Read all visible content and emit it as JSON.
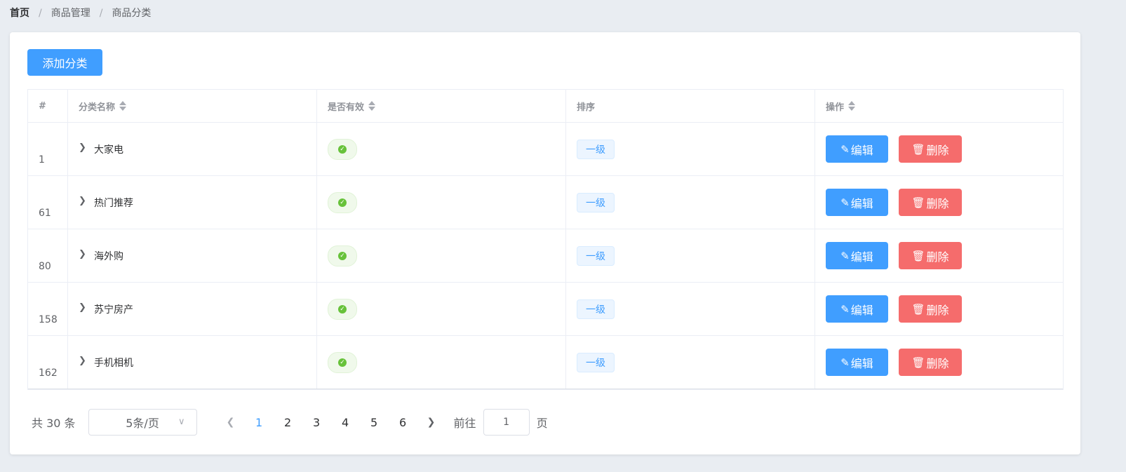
{
  "breadcrumb": {
    "home": "首页",
    "sep": "/",
    "level1": "商品管理",
    "level2": "商品分类"
  },
  "toolbar": {
    "add_label": "添加分类"
  },
  "table": {
    "headers": {
      "index": "#",
      "name": "分类名称",
      "valid": "是否有效",
      "sort": "排序",
      "ops": "操作"
    },
    "rows": [
      {
        "id": "1",
        "name": "大家电",
        "level": "一级"
      },
      {
        "id": "61",
        "name": "热门推荐",
        "level": "一级"
      },
      {
        "id": "80",
        "name": "海外购",
        "level": "一级"
      },
      {
        "id": "158",
        "name": "苏宁房产",
        "level": "一级"
      },
      {
        "id": "162",
        "name": "手机相机",
        "level": "一级"
      }
    ],
    "edit_label": "编辑",
    "delete_label": "删除"
  },
  "pagination": {
    "total_text": "共 30 条",
    "page_size": "5条/页",
    "pages": [
      "1",
      "2",
      "3",
      "4",
      "5",
      "6"
    ],
    "current_page": "1",
    "goto_prefix": "前往",
    "goto_value": "1",
    "goto_suffix": "页"
  },
  "colors": {
    "primary": "#409eff",
    "danger": "#f56c6c",
    "success": "#67c23a"
  },
  "icons": {
    "expand": "chevron-right-icon",
    "valid": "check-circle-icon",
    "edit": "edit-icon",
    "delete": "trash-icon",
    "sort": "sort-caret-icon"
  }
}
